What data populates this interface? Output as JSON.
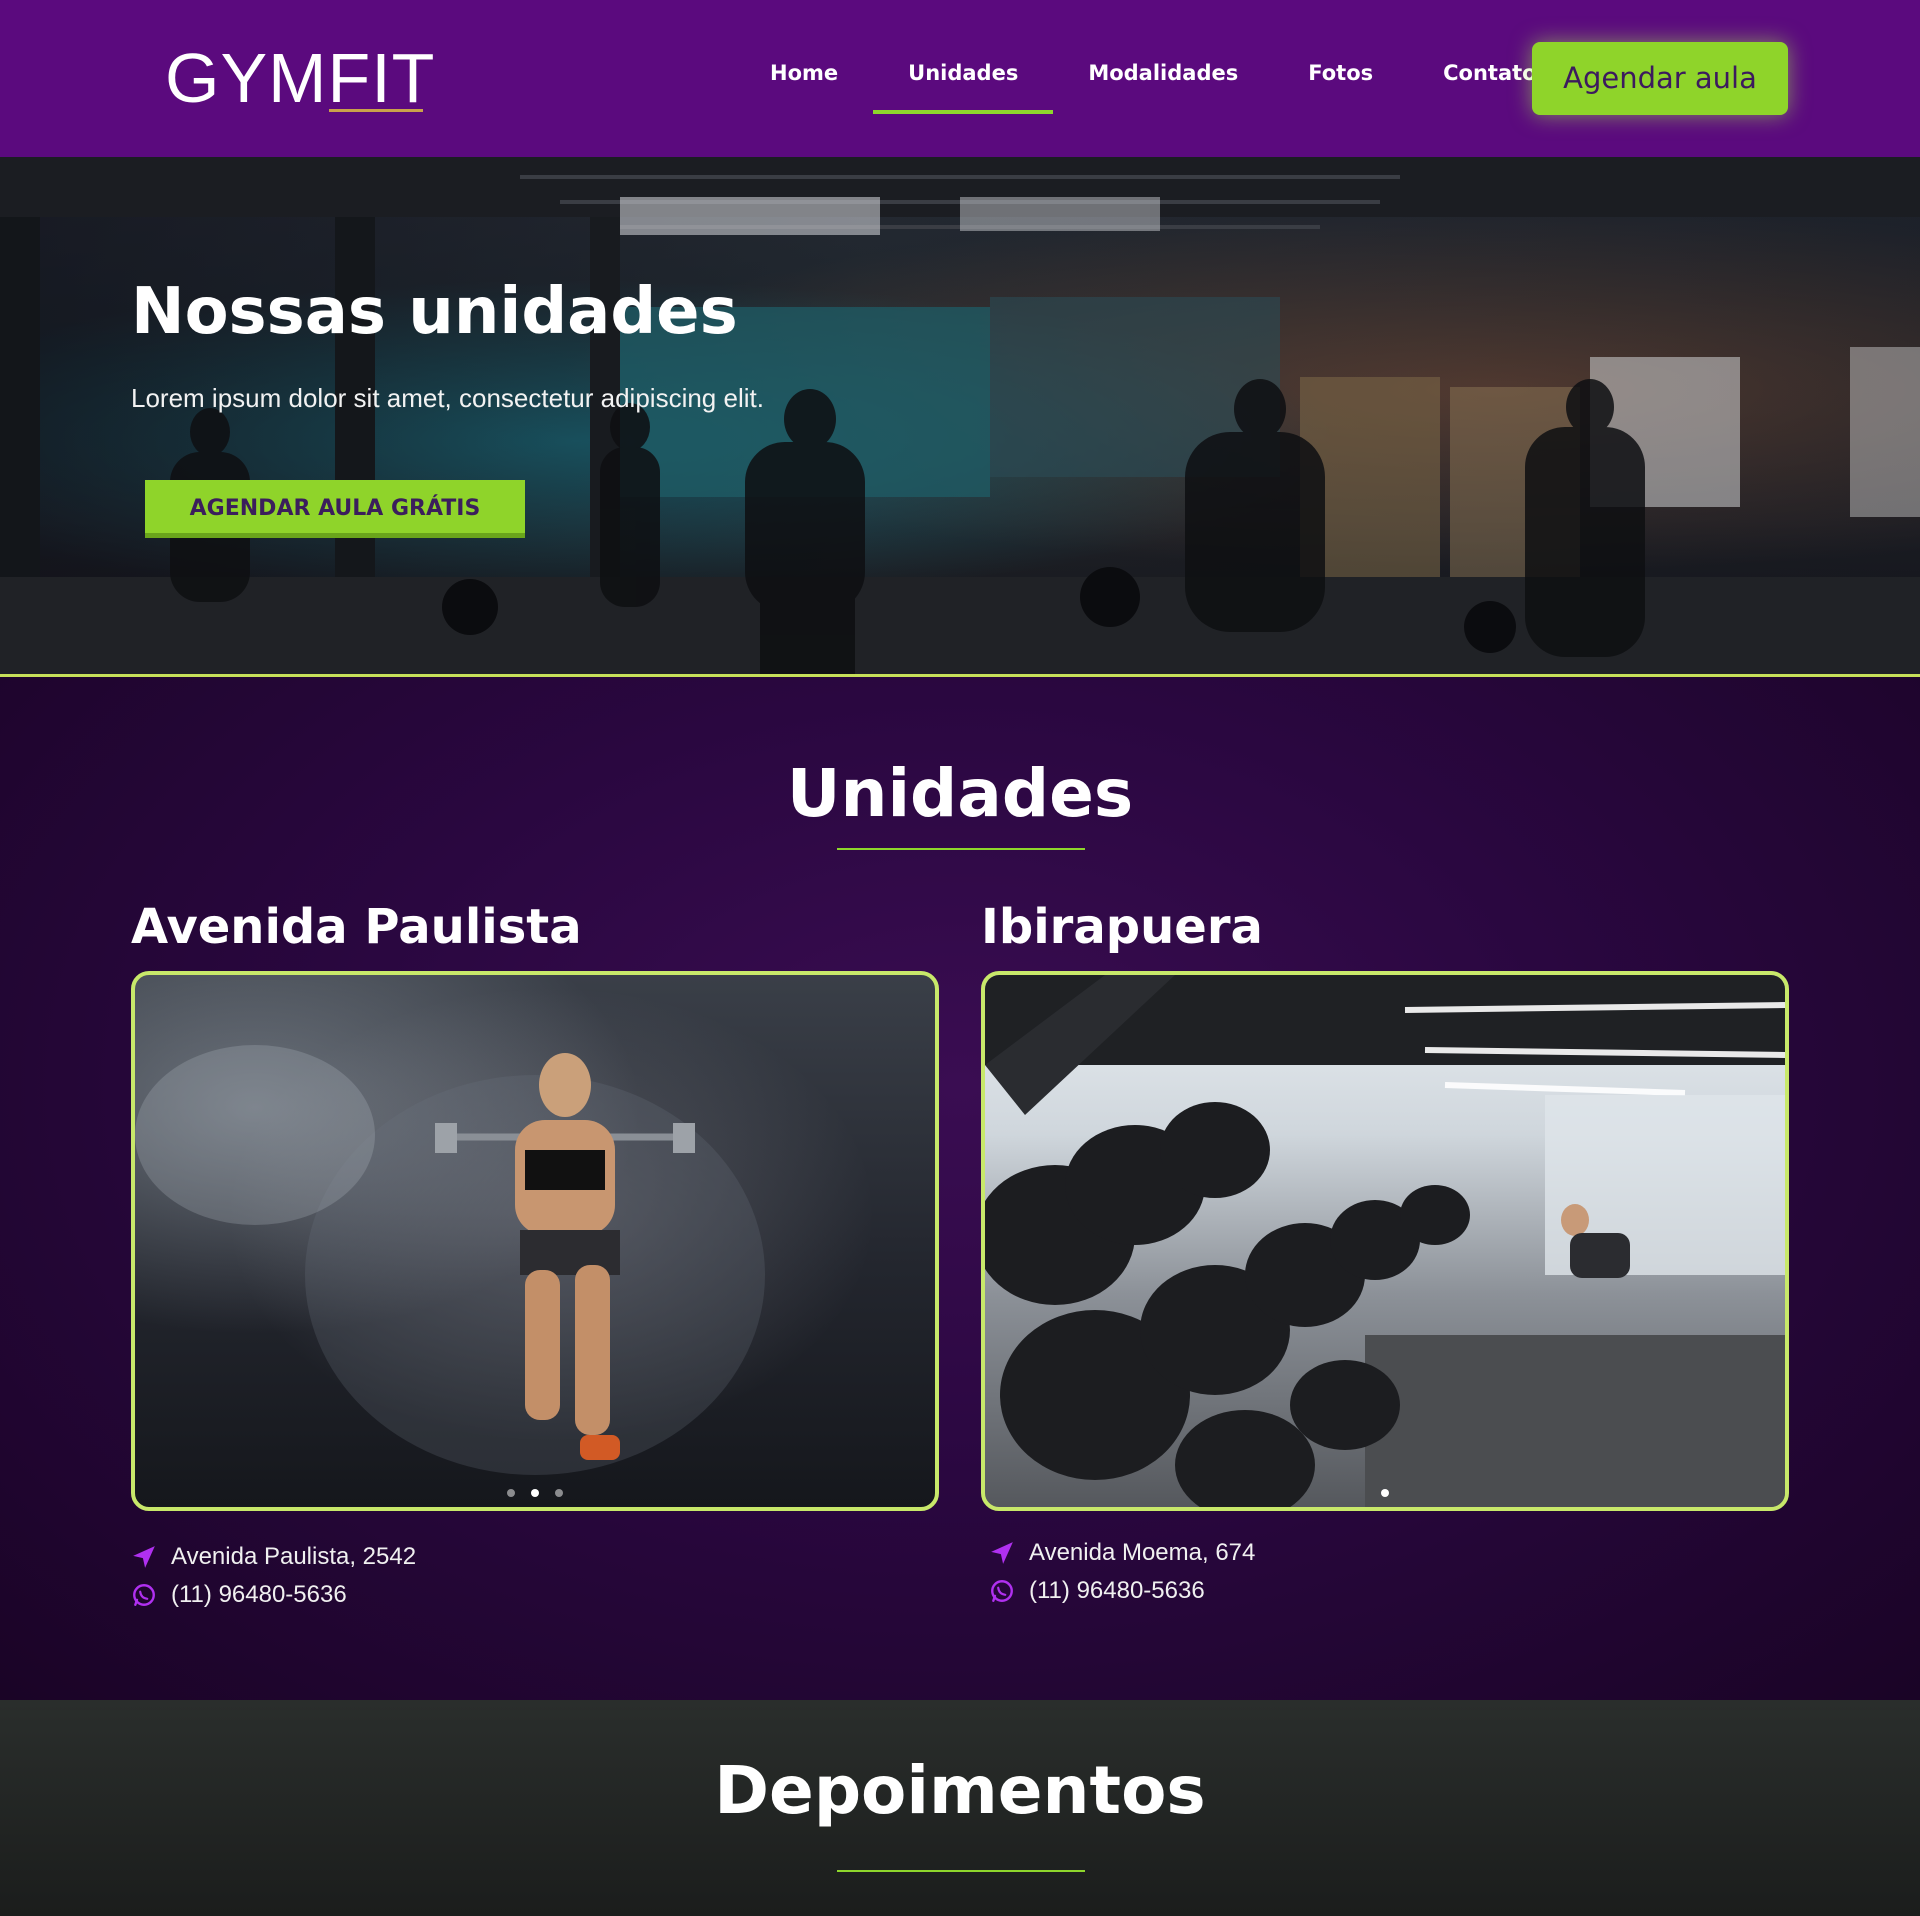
{
  "header": {
    "logo_prefix": "GYM",
    "logo_suffix": "FIT",
    "nav": [
      {
        "label": "Home"
      },
      {
        "label": "Unidades"
      },
      {
        "label": "Modalidades"
      },
      {
        "label": "Fotos"
      },
      {
        "label": "Contato"
      }
    ],
    "active_nav": "Unidades",
    "cta_label": "Agendar aula"
  },
  "hero": {
    "title": "Nossas unidades",
    "subtitle": "Lorem ipsum dolor sit amet, consectetur adipiscing elit.",
    "button_label": "AGENDAR AULA GRÁTIS"
  },
  "unidades": {
    "title": "Unidades",
    "units": [
      {
        "name": "Avenida Paulista",
        "address": "Avenida Paulista, 2542",
        "phone": "(11) 96480-5636",
        "active_slide": 2,
        "slide_count": 3
      },
      {
        "name": "Ibirapuera",
        "address": "Avenida Moema, 674",
        "phone": "(11) 96480-5636",
        "active_slide": 1,
        "slide_count": 1
      }
    ]
  },
  "depoimentos": {
    "title": "Depoimentos"
  },
  "colors": {
    "header_bg": "#5b0a7e",
    "accent_green": "#8fd42a",
    "icon_purple": "#b030f0",
    "section_bg": "#2a0740"
  },
  "icons": [
    "location-arrow-icon",
    "whatsapp-icon"
  ]
}
